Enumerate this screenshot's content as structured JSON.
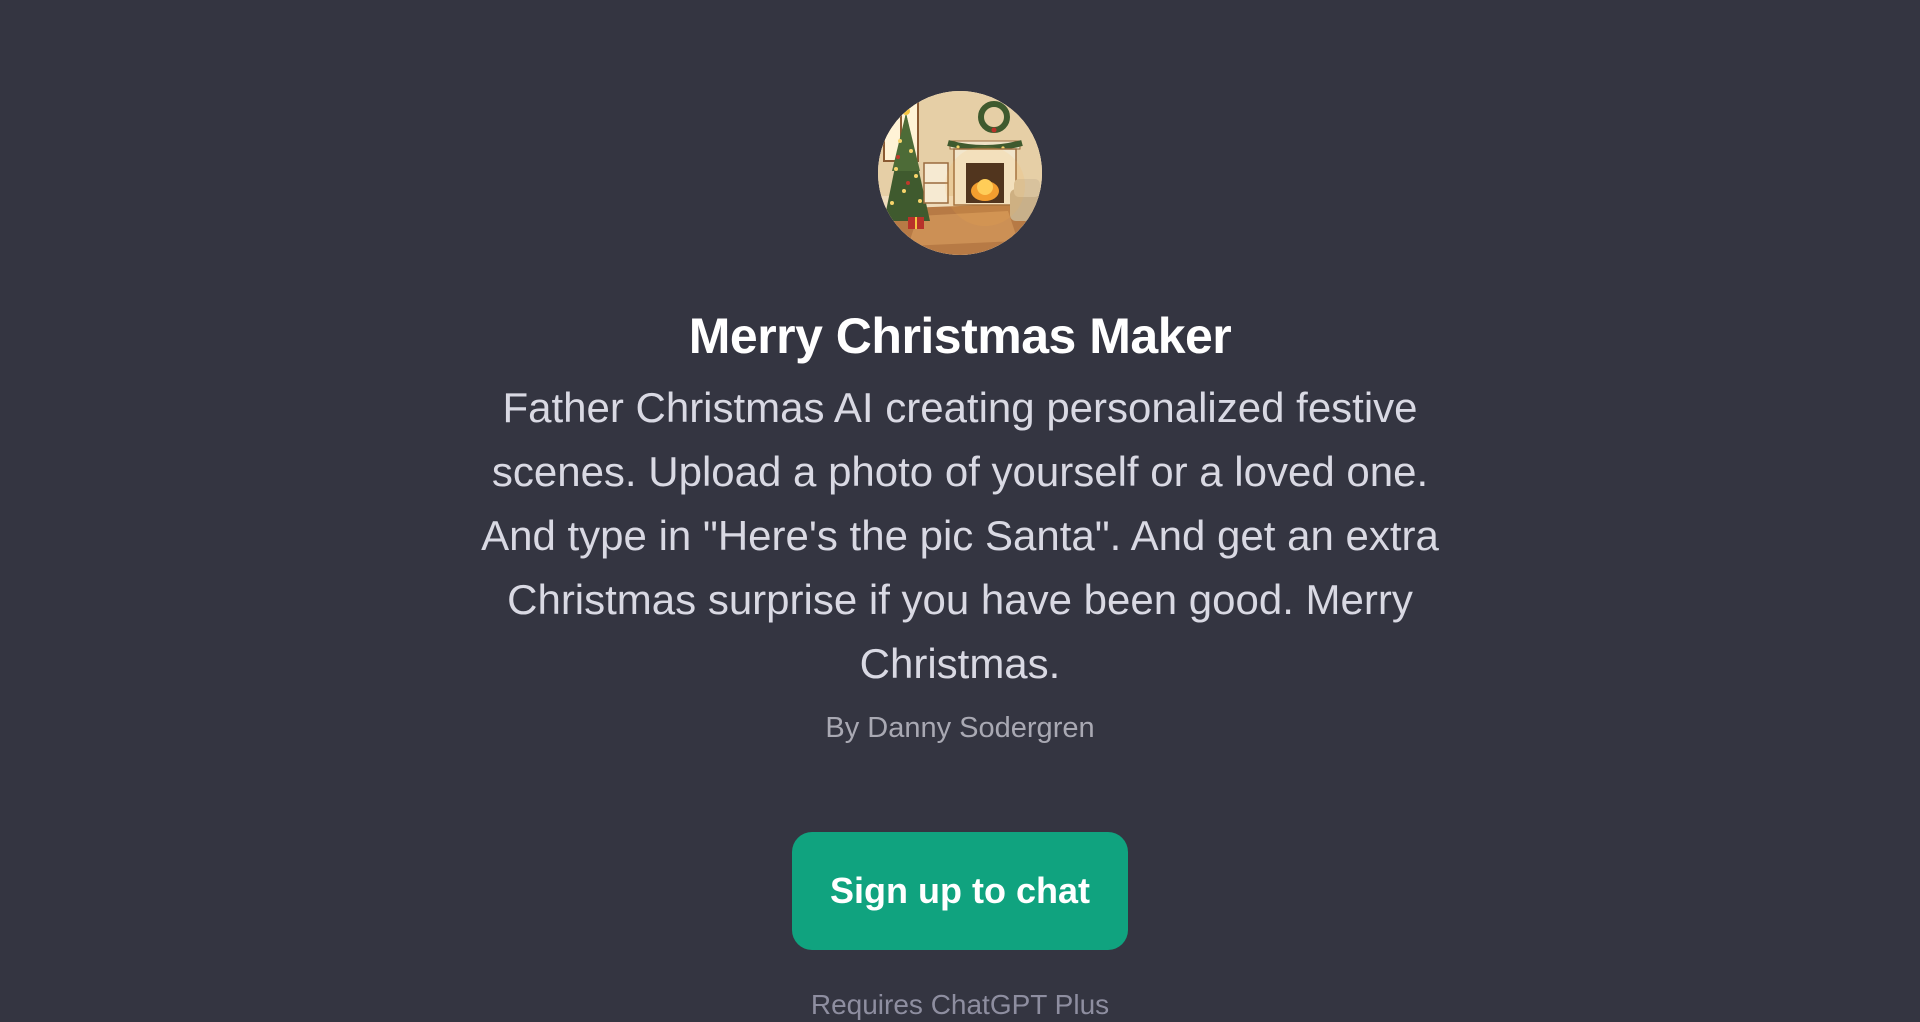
{
  "gpt": {
    "avatar_icon": "christmas-fireplace-scene",
    "name": "Merry Christmas Maker",
    "description": "Father Christmas AI creating personalized festive scenes. Upload a photo of yourself or a loved one. And type in \"Here's the pic Santa\". And get an extra Christmas surprise if you have been good. Merry Christmas.",
    "author": "By Danny Sodergren"
  },
  "actions": {
    "signup_label": "Sign up to chat"
  },
  "footer": {
    "text": "Requires ChatGPT Plus"
  },
  "colors": {
    "background": "#343541",
    "accent": "#10a37f"
  }
}
